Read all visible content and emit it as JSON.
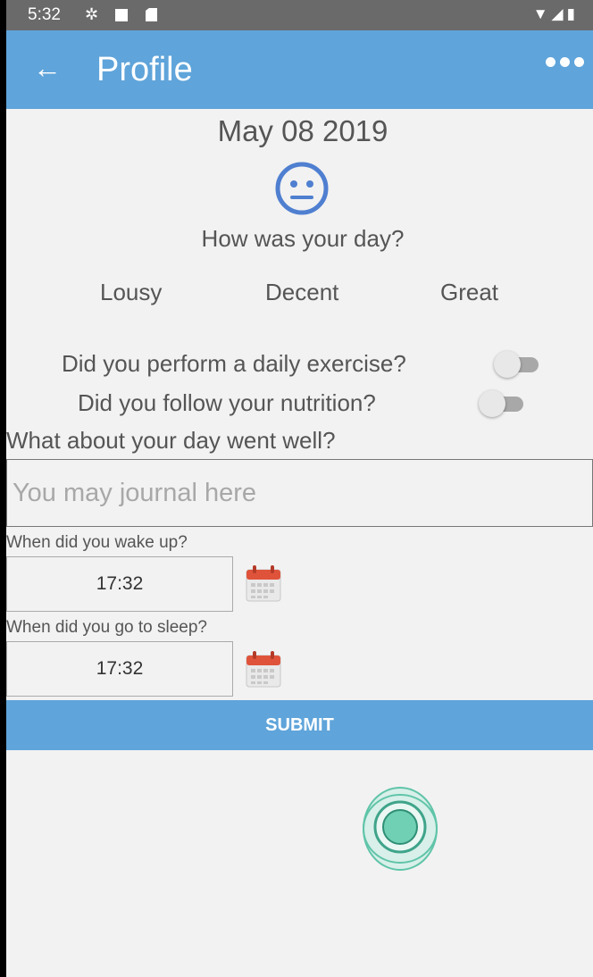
{
  "status_bar": {
    "time": "5:32"
  },
  "app_bar": {
    "title": "Profile",
    "back_icon": "arrow-left-icon",
    "menu_icon": "more-dots-icon"
  },
  "entry": {
    "date": "May 08 2019",
    "mood_icon": "neutral-face-icon",
    "question": "How was your day?",
    "ratings": [
      "Lousy",
      "Decent",
      "Great"
    ],
    "exercise_question": "Did you perform a daily exercise?",
    "exercise_checked": false,
    "nutrition_question": "Did you follow your nutrition?",
    "nutrition_checked": false,
    "journal_label": "What about your day went well?",
    "journal_placeholder": "You may journal here",
    "journal_value": "",
    "wake_label": "When did you wake up?",
    "wake_time": "17:32",
    "sleep_label": "When did you go to sleep?",
    "sleep_time": "17:32",
    "submit_label": "SUBMIT"
  },
  "colors": {
    "primary": "#5fa4da",
    "status_bar": "#6a6a6a",
    "mood_face": "#4f7fd0",
    "fab": "#5fc4a8",
    "calendar_red": "#e0533b"
  }
}
